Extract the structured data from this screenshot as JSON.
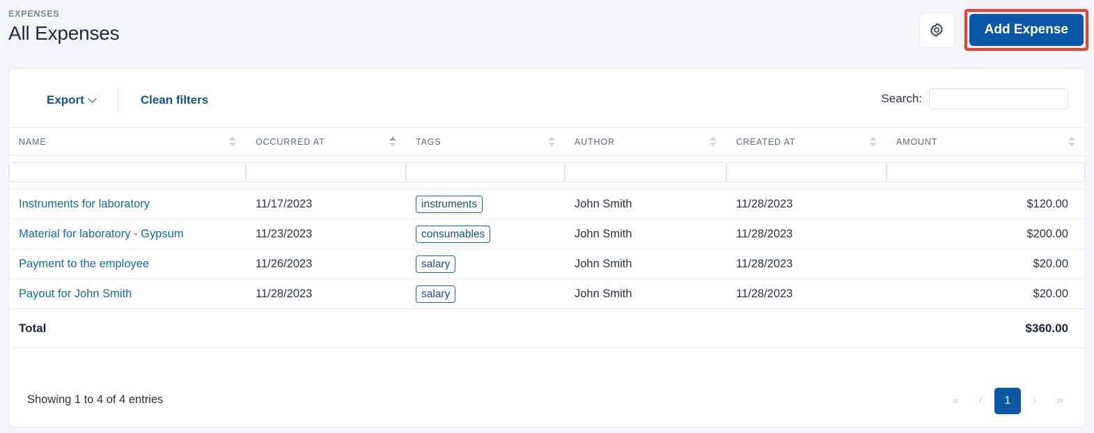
{
  "header": {
    "breadcrumb": "EXPENSES",
    "title": "All Expenses",
    "gear_icon": "gear-icon",
    "add_button_label": "Add Expense",
    "accent_blue": "#0d58a6",
    "highlight_color": "#f93a2f"
  },
  "toolbar": {
    "export_label": "Export",
    "export_caret_icon": "chevron-down-icon",
    "clean_filters_label": "Clean filters",
    "search_label": "Search:",
    "search_value": "",
    "search_placeholder": ""
  },
  "table": {
    "columns": [
      {
        "label": "NAME",
        "sort": "none",
        "align": "left"
      },
      {
        "label": "OCCURRED AT",
        "sort": "asc",
        "align": "left"
      },
      {
        "label": "TAGS",
        "sort": "none",
        "align": "left"
      },
      {
        "label": "AUTHOR",
        "sort": "none",
        "align": "left"
      },
      {
        "label": "CREATED AT",
        "sort": "none",
        "align": "left"
      },
      {
        "label": "AMOUNT",
        "sort": "none",
        "align": "left"
      }
    ],
    "filters": [
      "",
      "",
      "",
      "",
      "",
      ""
    ],
    "rows": [
      {
        "name": "Instruments for laboratory",
        "occurred_at": "11/17/2023",
        "tag": "instruments",
        "author": "John Smith",
        "created_at": "11/28/2023",
        "amount": "$120.00"
      },
      {
        "name": "Material for laboratory - Gypsum",
        "occurred_at": "11/23/2023",
        "tag": "consumables",
        "author": "John Smith",
        "created_at": "11/28/2023",
        "amount": "$200.00"
      },
      {
        "name": "Payment to the employee",
        "occurred_at": "11/26/2023",
        "tag": "salary",
        "author": "John Smith",
        "created_at": "11/28/2023",
        "amount": "$20.00"
      },
      {
        "name": "Payout for John Smith",
        "occurred_at": "11/28/2023",
        "tag": "salary",
        "author": "John Smith",
        "created_at": "11/28/2023",
        "amount": "$20.00"
      }
    ],
    "total_label": "Total",
    "total_amount": "$360.00"
  },
  "footer": {
    "showing_text": "Showing 1 to 4 of 4 entries",
    "pagination": {
      "first_label": "«",
      "prev_label": "‹",
      "pages": [
        "1"
      ],
      "current_page": "1",
      "next_label": "›",
      "last_label": "»"
    }
  }
}
